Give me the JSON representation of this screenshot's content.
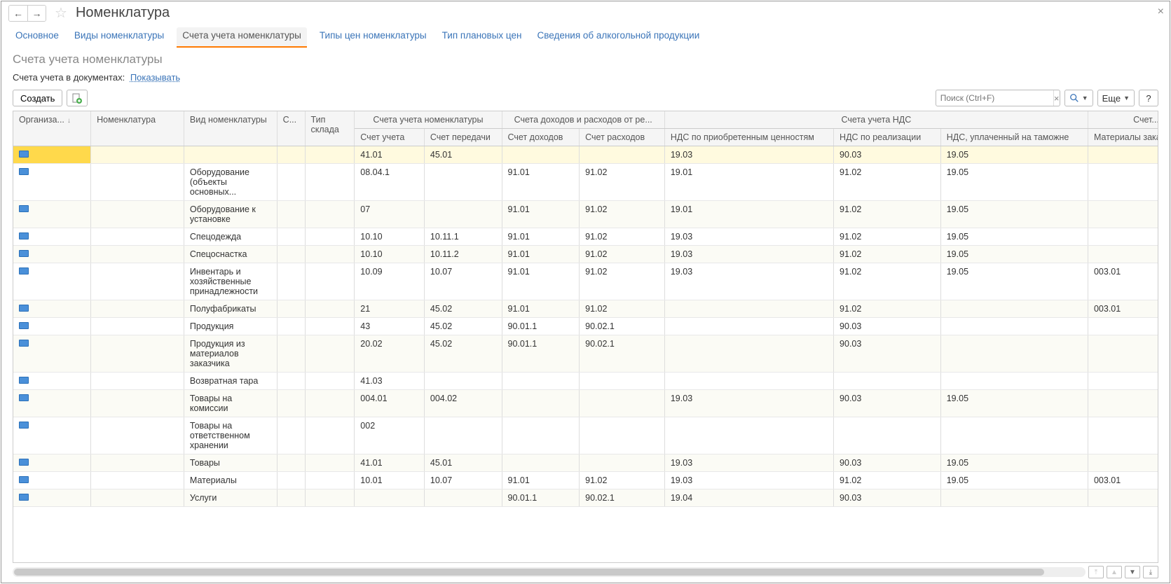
{
  "window": {
    "title": "Номенклатура",
    "subtitle": "Счета учета номенклатуры",
    "close_tooltip": "×"
  },
  "nav": {
    "back": "←",
    "forward": "→"
  },
  "tabs": [
    {
      "label": "Основное",
      "active": false
    },
    {
      "label": "Виды номенклатуры",
      "active": false
    },
    {
      "label": "Счета учета номенклатуры",
      "active": true
    },
    {
      "label": "Типы цен номенклатуры",
      "active": false
    },
    {
      "label": "Тип плановых цен",
      "active": false
    },
    {
      "label": "Сведения об алкогольной продукции",
      "active": false
    }
  ],
  "info": {
    "label": "Счета учета в документах:",
    "link": "Показывать"
  },
  "toolbar": {
    "create_label": "Создать",
    "more_label": "Еще",
    "help_label": "?",
    "search_placeholder": "Поиск (Ctrl+F)"
  },
  "columns": {
    "org": "Организа...",
    "nom": "Номенклатура",
    "vid": "Вид номенклатуры",
    "s": "С...",
    "tip": "Тип склада",
    "group_scheta": "Счета учета номенклатуры",
    "su": "Счет учета",
    "sp": "Счет передачи",
    "group_dohod": "Счета доходов и расходов от ре...",
    "sd": "Счет доходов",
    "sr": "Счет расходов",
    "group_nds": "Счета учета НДС",
    "nds1": "НДС по приобретенным ценностям",
    "nds2": "НДС по реализации",
    "nds3": "НДС, уплаченный на таможне",
    "group_scheta2": "Счет...",
    "mat": "Материалы заказчика"
  },
  "rows": [
    {
      "vid": "",
      "su": "41.01",
      "sp": "45.01",
      "sd": "",
      "sr": "",
      "nds1": "19.03",
      "nds2": "90.03",
      "nds3": "19.05",
      "mat": "",
      "selected": true
    },
    {
      "vid": "Оборудование (объекты основных...",
      "su": "08.04.1",
      "sp": "",
      "sd": "91.01",
      "sr": "91.02",
      "nds1": "19.01",
      "nds2": "91.02",
      "nds3": "19.05",
      "mat": ""
    },
    {
      "vid": "Оборудование к установке",
      "su": "07",
      "sp": "",
      "sd": "91.01",
      "sr": "91.02",
      "nds1": "19.01",
      "nds2": "91.02",
      "nds3": "19.05",
      "mat": ""
    },
    {
      "vid": "Спецодежда",
      "su": "10.10",
      "sp": "10.11.1",
      "sd": "91.01",
      "sr": "91.02",
      "nds1": "19.03",
      "nds2": "91.02",
      "nds3": "19.05",
      "mat": ""
    },
    {
      "vid": "Спецоснастка",
      "su": "10.10",
      "sp": "10.11.2",
      "sd": "91.01",
      "sr": "91.02",
      "nds1": "19.03",
      "nds2": "91.02",
      "nds3": "19.05",
      "mat": ""
    },
    {
      "vid": "Инвентарь и хозяйственные принадлежности",
      "su": "10.09",
      "sp": "10.07",
      "sd": "91.01",
      "sr": "91.02",
      "nds1": "19.03",
      "nds2": "91.02",
      "nds3": "19.05",
      "mat": "003.01"
    },
    {
      "vid": "Полуфабрикаты",
      "su": "21",
      "sp": "45.02",
      "sd": "91.01",
      "sr": "91.02",
      "nds1": "",
      "nds2": "91.02",
      "nds3": "",
      "mat": "003.01"
    },
    {
      "vid": "Продукция",
      "su": "43",
      "sp": "45.02",
      "sd": "90.01.1",
      "sr": "90.02.1",
      "nds1": "",
      "nds2": "90.03",
      "nds3": "",
      "mat": ""
    },
    {
      "vid": "Продукция из материалов заказчика",
      "su": "20.02",
      "sp": "45.02",
      "sd": "90.01.1",
      "sr": "90.02.1",
      "nds1": "",
      "nds2": "90.03",
      "nds3": "",
      "mat": ""
    },
    {
      "vid": "Возвратная тара",
      "su": "41.03",
      "sp": "",
      "sd": "",
      "sr": "",
      "nds1": "",
      "nds2": "",
      "nds3": "",
      "mat": ""
    },
    {
      "vid": "Товары на комиссии",
      "su": "004.01",
      "sp": "004.02",
      "sd": "",
      "sr": "",
      "nds1": "19.03",
      "nds2": "90.03",
      "nds3": "19.05",
      "mat": ""
    },
    {
      "vid": "Товары на ответственном хранении",
      "su": "002",
      "sp": "",
      "sd": "",
      "sr": "",
      "nds1": "",
      "nds2": "",
      "nds3": "",
      "mat": ""
    },
    {
      "vid": "Товары",
      "su": "41.01",
      "sp": "45.01",
      "sd": "",
      "sr": "",
      "nds1": "19.03",
      "nds2": "90.03",
      "nds3": "19.05",
      "mat": ""
    },
    {
      "vid": "Материалы",
      "su": "10.01",
      "sp": "10.07",
      "sd": "91.01",
      "sr": "91.02",
      "nds1": "19.03",
      "nds2": "91.02",
      "nds3": "19.05",
      "mat": "003.01"
    },
    {
      "vid": "Услуги",
      "su": "",
      "sp": "",
      "sd": "90.01.1",
      "sr": "90.02.1",
      "nds1": "19.04",
      "nds2": "90.03",
      "nds3": "",
      "mat": ""
    }
  ]
}
